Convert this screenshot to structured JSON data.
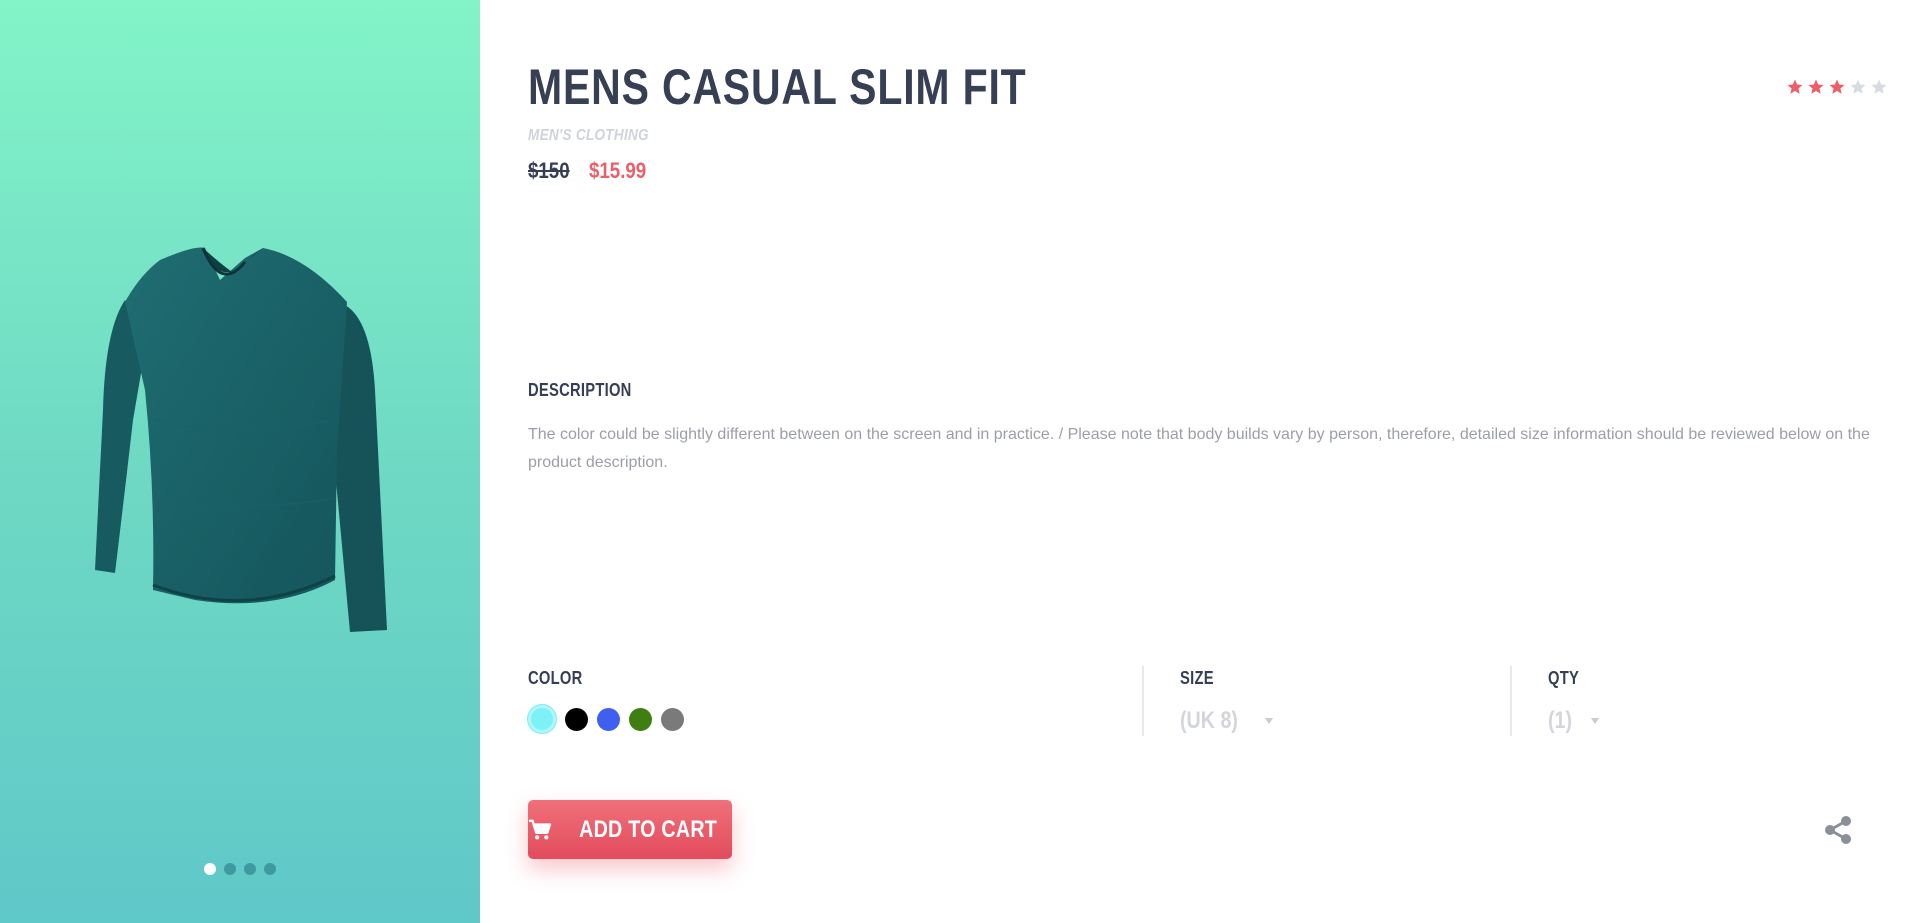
{
  "product": {
    "title": "MENS CASUAL SLIM FIT",
    "category": "MEN'S CLOTHING",
    "old_price": "$150",
    "new_price": "$15.99",
    "rating": 3,
    "rating_max": 5,
    "image_icon": "long-sleeve-shirt-image"
  },
  "gallery": {
    "dot_count": 4,
    "active_index": 0
  },
  "description": {
    "label": "DESCRIPTION",
    "text": "The color could be slightly different between on the screen and in practice. / Please note that body builds vary by person, therefore, detailed size information should be reviewed below on the product description."
  },
  "options": {
    "color_label": "COLOR",
    "colors": [
      "#7cf2f6",
      "#000000",
      "#3e5ff0",
      "#3f7f12",
      "#7a7a7a"
    ],
    "selected_color_index": 0,
    "size_label": "SIZE",
    "size_value": "(UK 8)",
    "qty_label": "QTY",
    "qty_value": "(1)"
  },
  "actions": {
    "add_to_cart_label": "ADD TO CART",
    "cart_icon": "cart-icon",
    "share_icon": "share-icon"
  },
  "theme": {
    "accent": "#ed5e68",
    "dark_text": "#363f53",
    "panel_gradient": [
      "#82f4c8",
      "#5fc8c8"
    ]
  }
}
